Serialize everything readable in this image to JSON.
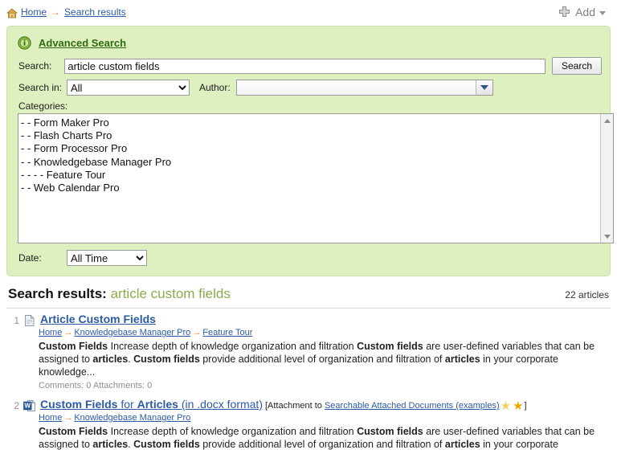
{
  "breadcrumb": {
    "home_label": "Home",
    "arrow": "→",
    "current_label": "Search results"
  },
  "add_menu": {
    "label": "Add"
  },
  "advanced_search": {
    "title": "Advanced Search",
    "search_label": "Search:",
    "search_value": "article custom fields",
    "search_button": "Search",
    "search_in_label": "Search in:",
    "search_in_value": "All",
    "search_in_options": [
      "All"
    ],
    "author_label": "Author:",
    "author_value": "",
    "categories_label": "Categories:",
    "categories": [
      "- - Form Maker Pro",
      "- - Flash Charts Pro",
      "- - Form Processor Pro",
      "- - Knowledgebase Manager Pro",
      "- - - - Feature Tour",
      "- - Web Calendar Pro"
    ],
    "date_label": "Date:",
    "date_value": "All Time",
    "date_options": [
      "All Time"
    ]
  },
  "results": {
    "heading": "Search results:",
    "query": "article custom fields",
    "count": "22 articles",
    "items": [
      {
        "number": "1",
        "icon": "document-icon",
        "title": "Article Custom Fields",
        "breadcrumb": [
          "Home",
          "Knowledgebase Manager Pro",
          "Feature Tour"
        ],
        "snippet_parts": [
          {
            "text": "Custom Fields",
            "bold": true
          },
          {
            "text": " Increase depth of knowledge organization and filtration ",
            "bold": false
          },
          {
            "text": "Custom fields",
            "bold": true
          },
          {
            "text": " are user-defined variables that can be assigned to ",
            "bold": false
          },
          {
            "text": "articles",
            "bold": true
          },
          {
            "text": ". ",
            "bold": false
          },
          {
            "text": "Custom fields",
            "bold": true
          },
          {
            "text": " provide additional level of organization and filtration of ",
            "bold": false
          },
          {
            "text": "articles",
            "bold": true
          },
          {
            "text": " in your corporate knowledge...",
            "bold": false
          }
        ],
        "meta": "Comments: 0  Attachments: 0"
      },
      {
        "number": "2",
        "icon": "word-document-icon",
        "title_parts": [
          {
            "text": "Custom Fields",
            "bold": true
          },
          {
            "text": " for ",
            "bold": false
          },
          {
            "text": "Articles",
            "bold": true
          },
          {
            "text": " (in .docx format)",
            "bold": false
          }
        ],
        "attachment_prefix": "[Attachment to ",
        "attachment_link": "Searchable Attached Documents (examples)",
        "attachment_suffix": "]",
        "breadcrumb": [
          "Home",
          "Knowledgebase Manager Pro"
        ],
        "snippet_parts": [
          {
            "text": "Custom Fields",
            "bold": true
          },
          {
            "text": " Increase depth of knowledge organization and filtration ",
            "bold": false
          },
          {
            "text": "Custom fields",
            "bold": true
          },
          {
            "text": " are user-defined variables that can be assigned to ",
            "bold": false
          },
          {
            "text": "articles",
            "bold": true
          },
          {
            "text": ". ",
            "bold": false
          },
          {
            "text": "Custom fields",
            "bold": true
          },
          {
            "text": " provide additional level of organization and filtration of ",
            "bold": false
          },
          {
            "text": "articles",
            "bold": true
          },
          {
            "text": " in your corporate",
            "bold": false
          }
        ],
        "meta": ""
      }
    ]
  },
  "colors": {
    "panel_bg": "#dff0c0",
    "link": "#2b5ba6",
    "arrow": "#e07b2a",
    "accent_green": "#2e6b12",
    "query_green": "#8aab4e",
    "star_gold": "#f0a500"
  }
}
